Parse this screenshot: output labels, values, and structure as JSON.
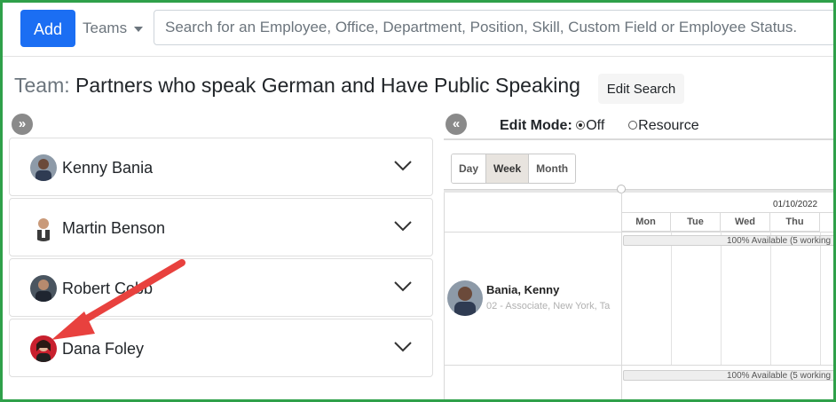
{
  "toolbar": {
    "add_label": "Add",
    "scope_label": "Teams",
    "search_placeholder": "Search for an Employee, Office, Department, Position, Skill, Custom Field or Employee Status."
  },
  "header": {
    "title_prefix": "Team:",
    "title_name": "Partners who speak German and Have Public Speaking",
    "edit_search_label": "Edit Search"
  },
  "employees": [
    {
      "name": "Kenny Bania",
      "icon": "chevron-down-icon"
    },
    {
      "name": "Martin Benson",
      "icon": "chevron-down-icon"
    },
    {
      "name": "Robert Cobb",
      "icon": "chevron-down-icon"
    },
    {
      "name": "Dana Foley",
      "icon": "chevron-down-icon"
    }
  ],
  "scheduler": {
    "edit_mode_label": "Edit Mode:",
    "edit_mode_options": [
      {
        "label": "Off",
        "selected": true
      },
      {
        "label": "Resource",
        "selected": false
      }
    ],
    "views": [
      {
        "label": "Day",
        "active": false
      },
      {
        "label": "Week",
        "active": true
      },
      {
        "label": "Month",
        "active": false
      }
    ],
    "date_label": "01/10/2022",
    "days": [
      "Mon",
      "Tue",
      "Wed",
      "Thu"
    ],
    "resource": {
      "name": "Bania, Kenny",
      "subtitle": "02 - Associate, New York, Ta"
    },
    "availability": [
      "100% Available (5 working",
      "100% Available (5 working"
    ]
  },
  "colors": {
    "frame_border": "#2fa04a",
    "primary_button": "#1b6ef3",
    "annotation_arrow": "#e8413e"
  }
}
